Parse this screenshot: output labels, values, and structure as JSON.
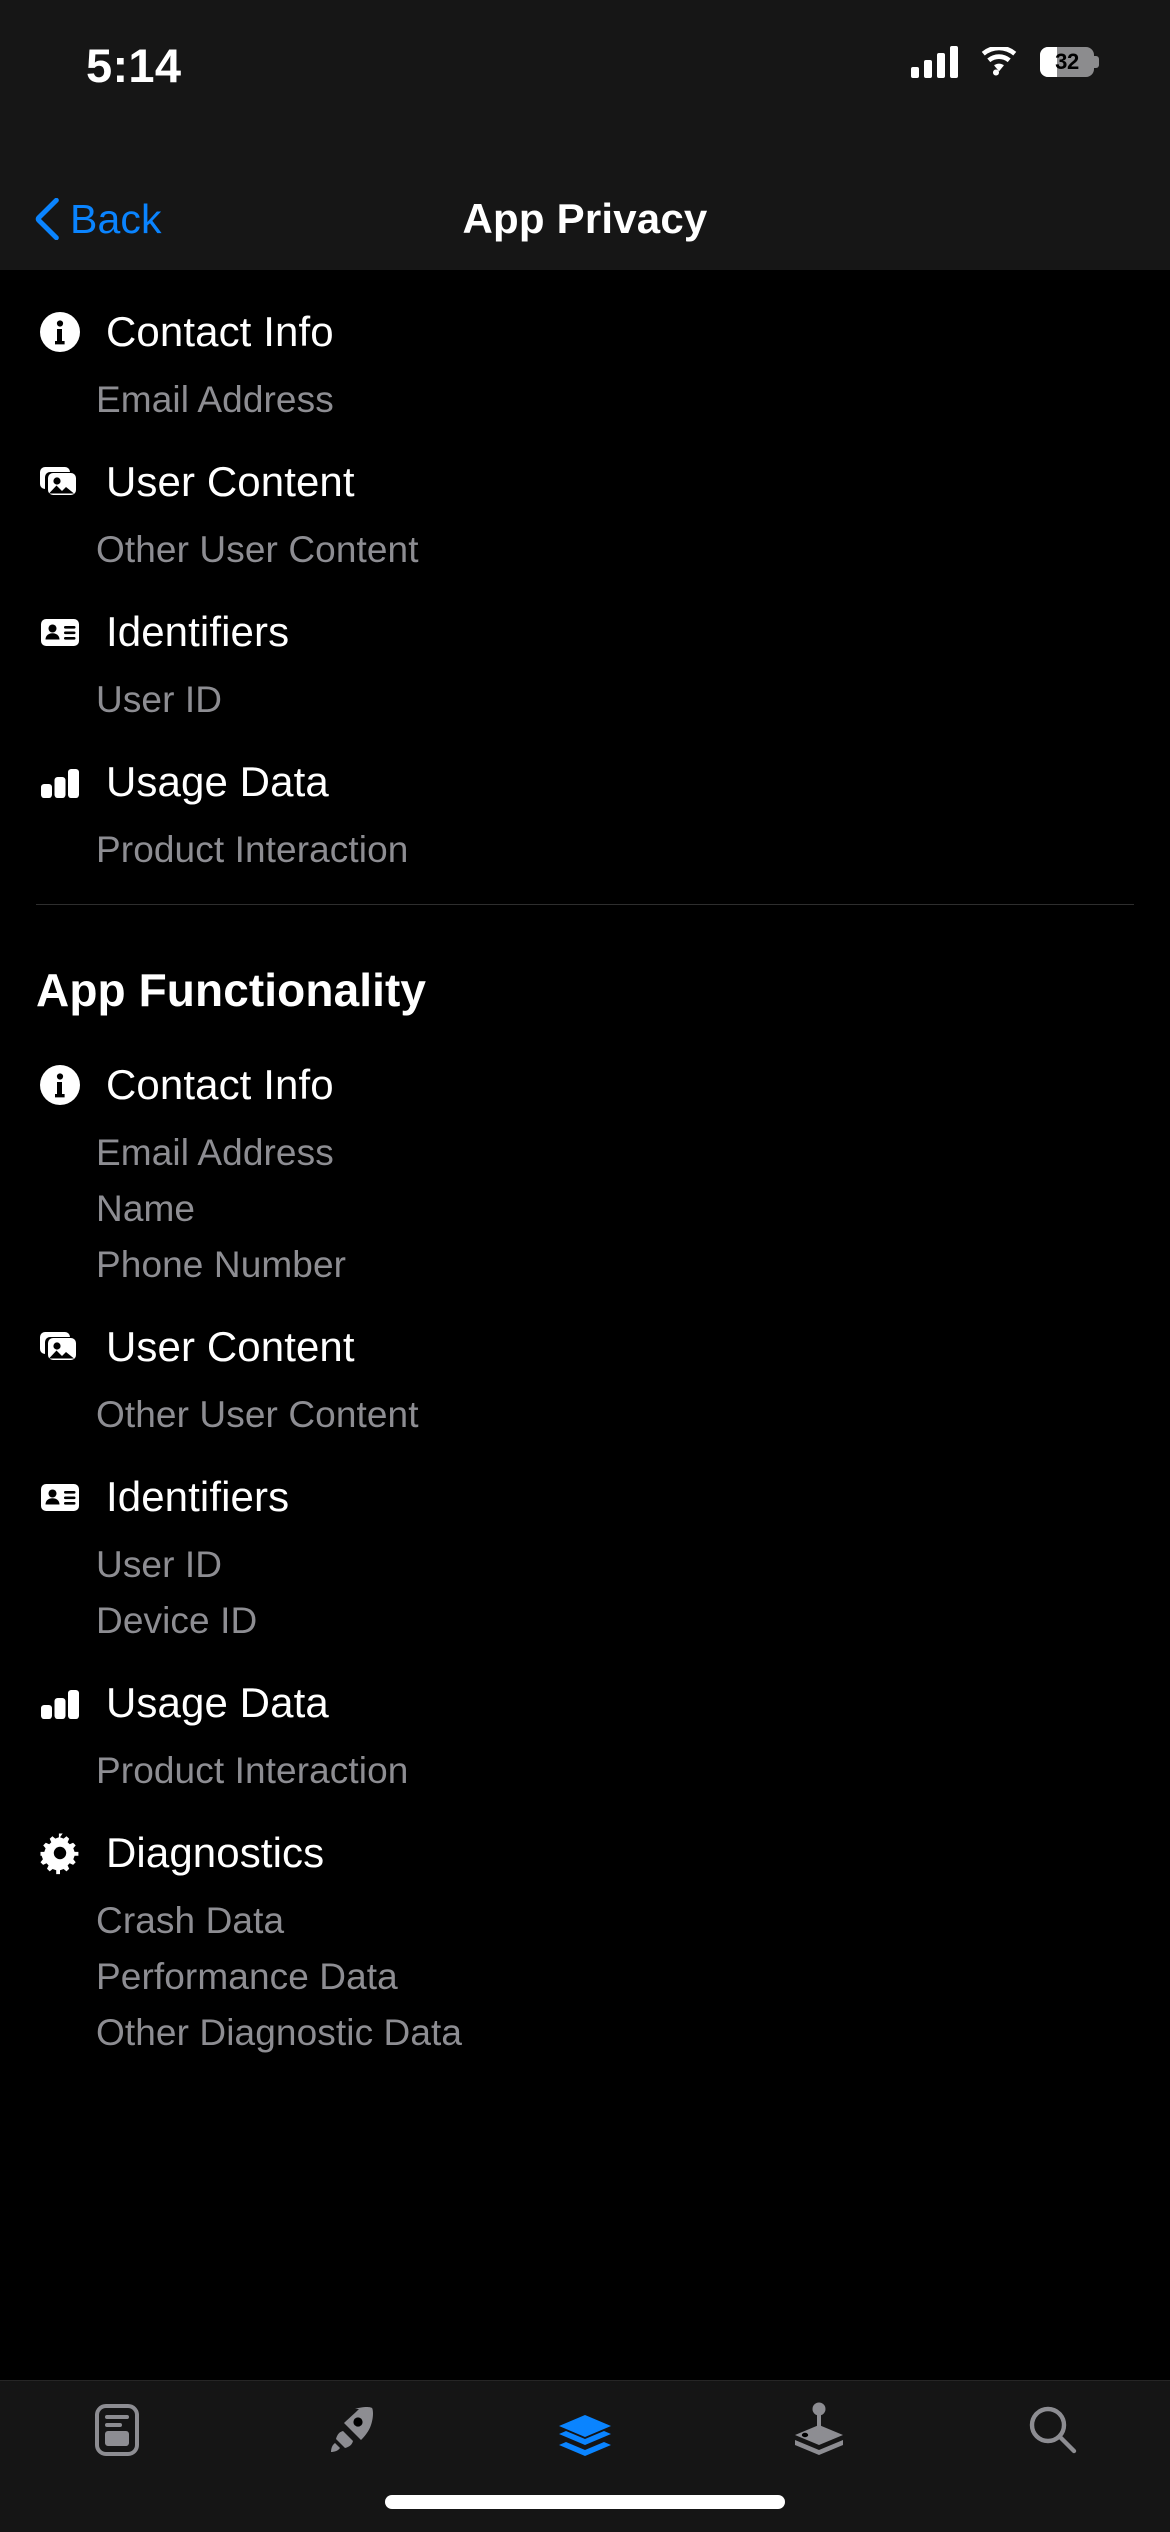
{
  "status_bar": {
    "time": "5:14",
    "battery_percent": "32",
    "battery_level": 32,
    "icons": [
      "cellular-signal-icon",
      "wifi-icon",
      "battery-icon"
    ]
  },
  "nav_bar": {
    "back_label": "Back",
    "title": "App Privacy",
    "accent_color": "#0a84ff"
  },
  "sections": [
    {
      "title": "",
      "categories": [
        {
          "icon": "info-circle-icon",
          "name": "Contact Info",
          "items": [
            "Email Address"
          ]
        },
        {
          "icon": "photo-stack-icon",
          "name": "User Content",
          "items": [
            "Other User Content"
          ]
        },
        {
          "icon": "id-card-icon",
          "name": "Identifiers",
          "items": [
            "User ID"
          ]
        },
        {
          "icon": "bar-chart-icon",
          "name": "Usage Data",
          "items": [
            "Product Interaction"
          ]
        }
      ]
    },
    {
      "title": "App Functionality",
      "categories": [
        {
          "icon": "info-circle-icon",
          "name": "Contact Info",
          "items": [
            "Email Address",
            "Name",
            "Phone Number"
          ]
        },
        {
          "icon": "photo-stack-icon",
          "name": "User Content",
          "items": [
            "Other User Content"
          ]
        },
        {
          "icon": "id-card-icon",
          "name": "Identifiers",
          "items": [
            "User ID",
            "Device ID"
          ]
        },
        {
          "icon": "bar-chart-icon",
          "name": "Usage Data",
          "items": [
            "Product Interaction"
          ]
        },
        {
          "icon": "gear-icon",
          "name": "Diagnostics",
          "items": [
            "Crash Data",
            "Performance Data",
            "Other Diagnostic Data"
          ]
        }
      ]
    }
  ],
  "tab_bar": {
    "active_color": "#0a84ff",
    "inactive_color": "#8d8d92",
    "tabs": [
      {
        "label": "Today",
        "icon": "today-card-icon",
        "active": false
      },
      {
        "label": "Games",
        "icon": "rocket-icon",
        "active": false
      },
      {
        "label": "Apps",
        "icon": "layers-stack-icon",
        "active": true
      },
      {
        "label": "Arcade",
        "icon": "joystick-icon",
        "active": false
      },
      {
        "label": "Search",
        "icon": "magnifier-icon",
        "active": false
      }
    ]
  }
}
